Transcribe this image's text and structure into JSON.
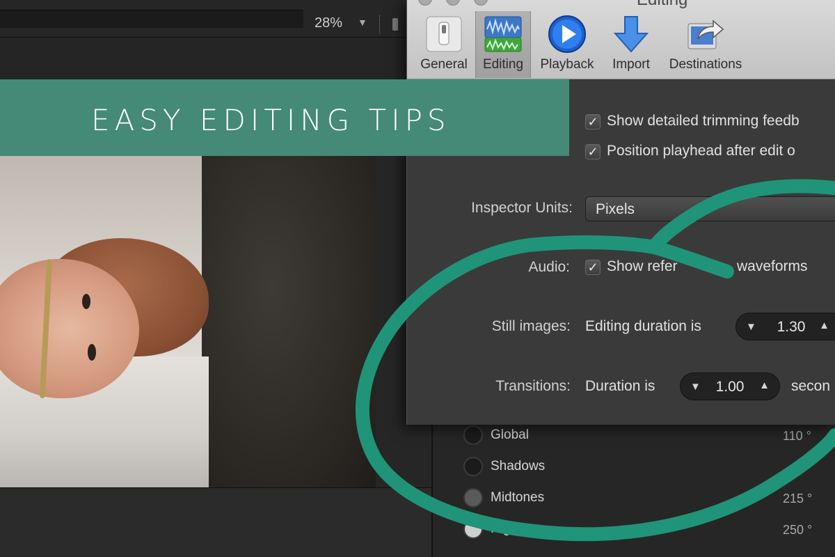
{
  "viewer": {
    "zoom": "28%",
    "zoom_caret": "▼"
  },
  "banner": {
    "title": "EASY EDITING TIPS",
    "color": "#458977"
  },
  "prefs_window": {
    "title": "Editing",
    "toolbar": [
      {
        "label": "General",
        "icon": "switch-icon"
      },
      {
        "label": "Editing",
        "icon": "waveform-icon"
      },
      {
        "label": "Playback",
        "icon": "play-icon"
      },
      {
        "label": "Import",
        "icon": "arrow-down-icon"
      },
      {
        "label": "Destinations",
        "icon": "share-icon"
      }
    ],
    "selected_tab": "Editing",
    "options": {
      "trimming_feedback": "Show detailed trimming feedb",
      "playhead_after_edit": "Position playhead after edit o",
      "inspector_units_label": "Inspector Units:",
      "inspector_units_value": "Pixels",
      "audio_label": "Audio:",
      "audio_option_part1": "Show refer",
      "audio_option_part2": "waveforms",
      "still_images_label": "Still images:",
      "still_images_text": "Editing duration is",
      "still_images_value": "1.30",
      "transitions_label": "Transitions:",
      "transitions_text": "Duration is",
      "transitions_value": "1.00",
      "transitions_unit": "secon"
    }
  },
  "color_board": {
    "rows": [
      {
        "label": "Global",
        "value": "110 °"
      },
      {
        "label": "Shadows",
        "value": ""
      },
      {
        "label": "Midtones",
        "value": "215 °"
      },
      {
        "label": "Hig",
        "value": "250 °"
      }
    ]
  },
  "scribble_color": "#1f9478"
}
